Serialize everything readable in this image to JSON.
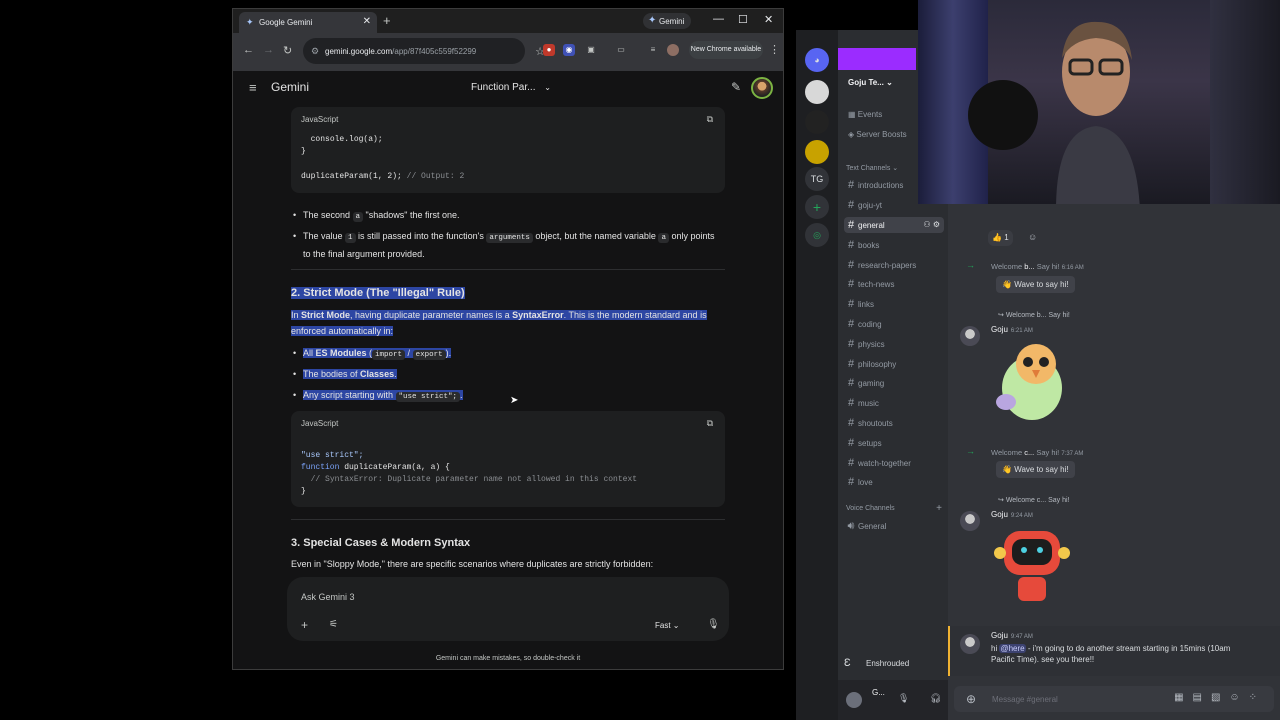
{
  "chrome": {
    "tab_title": "Google Gemini",
    "gemini_pill": "Gemini",
    "url_domain": "gemini.google.com",
    "url_path": "/app/87f405c559f52299",
    "new_chrome": "New Chrome available"
  },
  "gemini": {
    "app_title": "Gemini",
    "conversation_title": "Function Par...",
    "code1": {
      "lang": "JavaScript",
      "line1": "console.log(a);",
      "line2": "}",
      "line3": "duplicateParam(1, 2);",
      "line3_comment": "// Output: 2"
    },
    "bullet1": {
      "pre": "The second ",
      "code": "a",
      "post": " \"shadows\" the first one."
    },
    "bullet2": {
      "pre": "The value ",
      "code1": "1",
      "mid": " is still passed into the function's ",
      "code2": "arguments",
      "mid2": " object, but the named variable ",
      "code3": "a",
      "post": " only points to the final argument provided."
    },
    "section2": {
      "heading": "2. Strict Mode (The \"Illegal\" Rule)",
      "p_pre": "In ",
      "p_b1": "Strict Mode",
      "p_mid": ", having duplicate parameter names is a ",
      "p_b2": "SyntaxError",
      "p_post": ". This is the modern standard and is enforced automatically in:",
      "li1_pre": "All ",
      "li1_b": "ES Modules",
      "li1_open": " (",
      "li1_c1": "import",
      "li1_sep": " / ",
      "li1_c2": "export",
      "li1_close": ").",
      "li2_pre": "The bodies of ",
      "li2_b": "Classes",
      "li2_post": ".",
      "li3_pre": "Any script starting with ",
      "li3_c": "\"use strict\";",
      "li3_post": "."
    },
    "code2": {
      "lang": "JavaScript",
      "line1": "\"use strict\";",
      "line2_kw": "function",
      "line2": " duplicateParam(a, a) {",
      "line3": "// SyntaxError: Duplicate parameter name not allowed in this context",
      "line4": "}"
    },
    "section3": {
      "heading": "3. Special Cases & Modern Syntax",
      "p": "Even in \"Sloppy Mode,\" there are specific scenarios where duplicates are strictly forbidden:"
    },
    "prompt": {
      "placeholder": "Ask Gemini 3",
      "mode": "Fast"
    },
    "disclaimer": "Gemini can make mistakes, so double-check it"
  },
  "discord": {
    "server_name": "Goju Te...",
    "menu": [
      "Events",
      "Server Boosts"
    ],
    "guild_tg": "TG",
    "text_category": "Text Channels",
    "channels": [
      "introductions",
      "goju-yt",
      "general",
      "books",
      "research-papers",
      "tech-news",
      "links",
      "coding",
      "physics",
      "philosophy",
      "gaming",
      "music",
      "shoutouts",
      "setups",
      "watch-together",
      "love"
    ],
    "active_channel": "general",
    "voice_category": "Voice Channels",
    "voice_channels": [
      "General"
    ],
    "voice_status": "Enshrouded",
    "user_short": "G...",
    "reaction_count": "1",
    "messages": {
      "welcome1": {
        "pre": "Welcome ",
        "name": "b...",
        "post": " Say hi!",
        "time": "6:16 AM",
        "wave": "Wave to say hi!"
      },
      "msg1": {
        "reply": "Welcome b... Say hi!",
        "author": "Goju",
        "time": "6:21 AM"
      },
      "welcome2": {
        "pre": "Welcome ",
        "name": "c...",
        "post": " Say hi!",
        "time": "7:37 AM",
        "wave": "Wave to say hi!"
      },
      "msg2": {
        "reply": "Welcome c... Say hi!",
        "author": "Goju",
        "time": "9:24 AM"
      },
      "msg3": {
        "author": "Goju",
        "time": "9:47 AM",
        "pre": "hi ",
        "mention": "@here",
        "post": " - i'm going to do another stream starting in 15mins (10am Pacific Time). see you there!!"
      }
    },
    "input_placeholder": "Message #general"
  },
  "colors": {
    "selection": "#2d46a3",
    "discord_bg": "#313338",
    "gemini_bg": "#131314",
    "accent": "#a8c7fa"
  }
}
